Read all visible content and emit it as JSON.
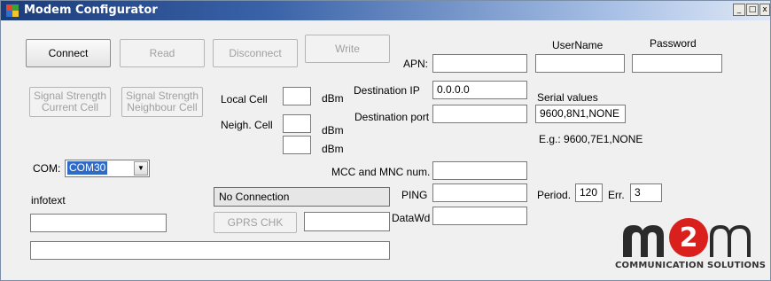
{
  "window": {
    "title": "Modem Configurator",
    "controls": {
      "minimize": "_",
      "maximize": "□",
      "close": "x"
    }
  },
  "buttons": {
    "connect": "Connect",
    "read": "Read",
    "disconnect": "Disconnect",
    "write": "Write",
    "signal_current": "Signal Strength Current Cell",
    "signal_neighbour": "Signal Strength Neighbour Cell",
    "gprs_chk": "GPRS CHK"
  },
  "cells": {
    "local_label": "Local Cell",
    "neigh_label": "Neigh. Cell",
    "unit": "dBm"
  },
  "com": {
    "label": "COM:",
    "selected": "COM30"
  },
  "infotext": {
    "label": "infotext"
  },
  "status": {
    "connection": "No Connection"
  },
  "apn": {
    "label": "APN:",
    "value": ""
  },
  "destination": {
    "ip_label": "Destination IP",
    "ip_value": "0.0.0.0",
    "port_label": "Destination port",
    "port_value": ""
  },
  "mcc": {
    "label": "MCC and MNC num.",
    "value": ""
  },
  "ping": {
    "label": "PING",
    "value": ""
  },
  "datawd": {
    "label": "DataWd",
    "value": ""
  },
  "credentials": {
    "username_label": "UserName",
    "password_label": "Password"
  },
  "serial": {
    "label": "Serial values",
    "value": "9600,8N1,NONE",
    "example": "E.g.: 9600,7E1,NONE"
  },
  "period": {
    "label": "Period.",
    "value": "120",
    "err_label": "Err.",
    "err_value": "3"
  },
  "logo": {
    "tagline": "COMMUNICATION SOLUTIONS"
  },
  "colors": {
    "title_start": "#1c3c7c",
    "logo_dark": "#2b2b2b",
    "logo_red": "#d9201d"
  }
}
